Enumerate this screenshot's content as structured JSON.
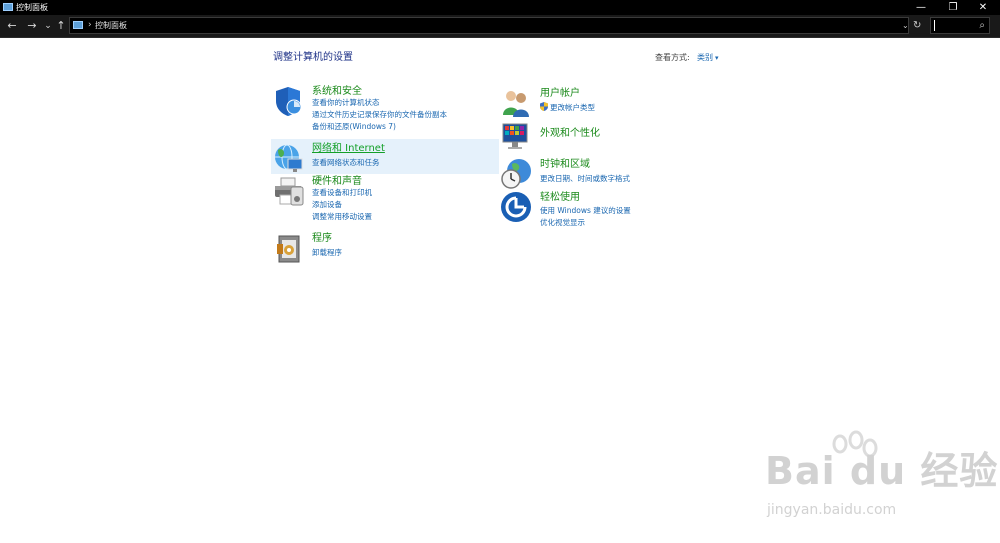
{
  "window": {
    "title": "控制面板",
    "controls": {
      "minimize": "—",
      "restore": "❐",
      "close": "✕"
    }
  },
  "address_bar": {
    "back": "←",
    "forward": "→",
    "recent": "⌄",
    "up": "↑",
    "separator": "›",
    "breadcrumb": "控制面板",
    "dropdown": "⌄",
    "refresh": "↻",
    "search_icon": "⌕"
  },
  "main": {
    "heading": "调整计算机的设置",
    "view_by_label": "查看方式:",
    "view_by_value": "类别"
  },
  "categories": [
    {
      "icon": "shield-icon",
      "title": "系统和安全",
      "links": [
        "查看你的计算机状态",
        "通过文件历史记录保存你的文件备份副本",
        "备份和还原(Windows 7)"
      ]
    },
    {
      "icon": "network-globe-icon",
      "title": "网络和 Internet",
      "links": [
        "查看网络状态和任务"
      ]
    },
    {
      "icon": "printer-icon",
      "title": "硬件和声音",
      "links": [
        "查看设备和打印机",
        "添加设备",
        "调整常用移动设置"
      ]
    },
    {
      "icon": "programs-icon",
      "title": "程序",
      "links": [
        "卸载程序"
      ]
    },
    {
      "icon": "users-icon",
      "title": "用户帐户",
      "links": [
        "更改帐户类型"
      ]
    },
    {
      "icon": "appearance-icon",
      "title": "外观和个性化",
      "links": []
    },
    {
      "icon": "clock-globe-icon",
      "title": "时钟和区域",
      "links": [
        "更改日期、时间或数字格式"
      ]
    },
    {
      "icon": "accessibility-icon",
      "title": "轻松使用",
      "links": [
        "使用 Windows 建议的设置",
        "优化视觉显示"
      ]
    }
  ],
  "watermark": {
    "main": "Bai du 经验",
    "sub": "jingyan.baidu.com"
  },
  "colors": {
    "title_green": "#1b8a1b",
    "link_blue": "#1a67b0",
    "heading_navy": "#1e3287",
    "hover": "#e5f1fb"
  }
}
